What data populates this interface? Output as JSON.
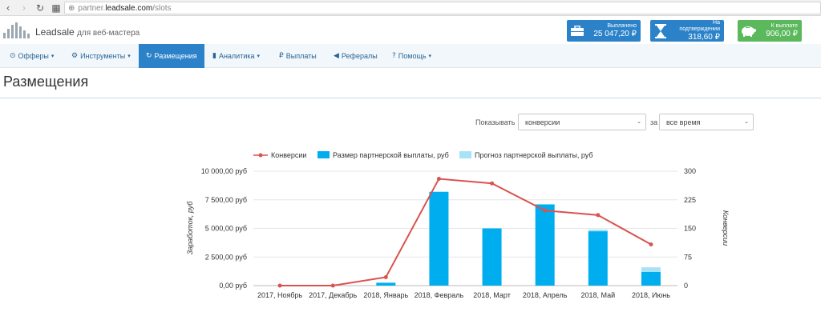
{
  "browser": {
    "url_prefix": "partner.",
    "url_domain": "leadsale.com",
    "url_path": "/slots"
  },
  "brand": {
    "name": "Leadsale",
    "tagline": "для веб-мастера"
  },
  "stats": [
    {
      "label": "Выплачено",
      "value": "25 047,20 ₽",
      "icon": "briefcase-icon",
      "color": "#2b82c9"
    },
    {
      "label": "На подтверждении",
      "value": "318,60 ₽",
      "icon": "hourglass-icon",
      "color": "#2b82c9"
    },
    {
      "label": "К выплате",
      "value": "906,00 ₽",
      "icon": "piggy-bank-icon",
      "color": "#5cb85c"
    }
  ],
  "nav": [
    {
      "label": "Офферы",
      "icon": "target-icon",
      "dropdown": true
    },
    {
      "label": "Инструменты",
      "icon": "gear-icon",
      "dropdown": true
    },
    {
      "label": "Размещения",
      "icon": "refresh-icon",
      "active": true
    },
    {
      "label": "Аналитика",
      "icon": "bar-chart-icon",
      "dropdown": true
    },
    {
      "label": "Выплаты",
      "icon": "ruble-icon"
    },
    {
      "label": "Рефералы",
      "icon": "megaphone-icon"
    },
    {
      "label": "Помощь",
      "icon": "question-icon",
      "dropdown": true
    }
  ],
  "page": {
    "title": "Размещения"
  },
  "filters": {
    "show_label": "Показывать",
    "show_value": "конверсии",
    "period_label": "за",
    "period_value": "все время"
  },
  "chart_data": {
    "type": "bar",
    "categories": [
      "2017, Ноябрь",
      "2017, Декабрь",
      "2018, Январь",
      "2018, Февраль",
      "2018, Март",
      "2018, Апрель",
      "2018, Май",
      "2018, Июнь"
    ],
    "series": [
      {
        "name": "Размер партнерской выплаты, руб",
        "type": "bar",
        "axis": "left",
        "color": "#00aeef",
        "values": [
          0,
          0,
          250,
          8200,
          5000,
          7100,
          4750,
          1200
        ]
      },
      {
        "name": "Прогноз партнерской выплаты, руб",
        "type": "bar",
        "stacked": true,
        "axis": "left",
        "color": "#a8e2f7",
        "values": [
          0,
          0,
          0,
          0,
          0,
          0,
          150,
          400
        ]
      },
      {
        "name": "Конверсии",
        "type": "line",
        "axis": "right",
        "color": "#d9534f",
        "values": [
          0,
          0,
          22,
          280,
          268,
          197,
          185,
          108
        ]
      }
    ],
    "ylabel": "Заработок, руб",
    "y2label": "Конверсии",
    "ylim": [
      0,
      10000
    ],
    "y2lim": [
      0,
      300
    ],
    "yticks": [
      "0,00 руб",
      "2 500,00 руб",
      "5 000,00 руб",
      "7 500,00 руб",
      "10 000,00 руб"
    ],
    "y2ticks": [
      "0",
      "75",
      "150",
      "225",
      "300"
    ],
    "legend": "top"
  }
}
